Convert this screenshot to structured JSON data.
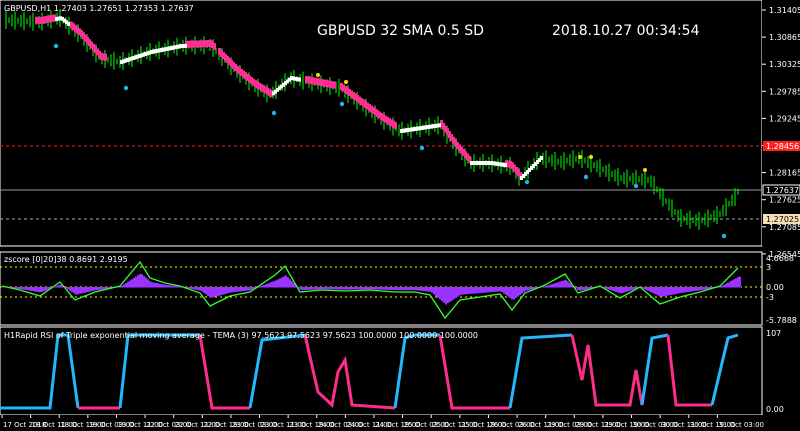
{
  "main": {
    "label": "GBPUSD,H1  1.27403 1.27651 1.27353 1.27637",
    "overlay_title": "GBPUSD  32 SMA  0.5 SD",
    "overlay_datetime": "2018.10.27 00:34:54",
    "price_ticks": [
      "1.31405",
      "1.30865",
      "1.30325",
      "1.29785",
      "1.29245",
      "1.28705",
      "1.28165",
      "1.27625",
      "1.27085",
      "1.26545"
    ],
    "current_price": "1.27637",
    "red_line_price": "1.28456",
    "lower_line_price": "1.27025",
    "colors": {
      "bull_candle": "#00ff00",
      "pink_band": "#ff2d95",
      "white_band": "#ffffff",
      "blue_dot": "#1fb5e8",
      "yellow_dot": "#ffd700",
      "red_dashed": "#ff2020"
    }
  },
  "zscore": {
    "label": "zscore [0|20]38 0.8691 2.9195",
    "ticks": [
      "4.6668",
      "3",
      "0.00",
      "-3",
      "-5.7888"
    ],
    "colors": {
      "line": "#33ff33",
      "hist": "#9933ff",
      "hline": "#ffff00"
    }
  },
  "rsi": {
    "label": "H1Rapid RSI of Triple exponential moving average - TEMA (3) 97.5623 97.5623 97.5623 100.0000 100.0000 100.0000",
    "ticks": [
      "107",
      "0.00"
    ],
    "colors": {
      "up": "#22b8ff",
      "down": "#ff2d8a"
    }
  },
  "time_axis": [
    "17 Oct 2018",
    "18 Oct 11:00",
    "18 Oct 19:00",
    "19 Oct 03:00",
    "19 Oct 11:00",
    "22 Oct 03:00",
    "22 Oct 11:00",
    "22 Oct 19:00",
    "23 Oct 03:00",
    "23 Oct 11:00",
    "23 Oct 19:00",
    "24 Oct 03:00",
    "24 Oct 11:00",
    "24 Oct 19:00",
    "25 Oct 03:00",
    "25 Oct 11:00",
    "25 Oct 19:00",
    "26 Oct 03:00",
    "26 Oct 11:00",
    "29 Oct 03:00",
    "29 Oct 11:00",
    "29 Oct 19:00",
    "30 Oct 03:00",
    "30 Oct 11:00",
    "30 Oct 19:00",
    "31 Oct 03:00"
  ]
}
